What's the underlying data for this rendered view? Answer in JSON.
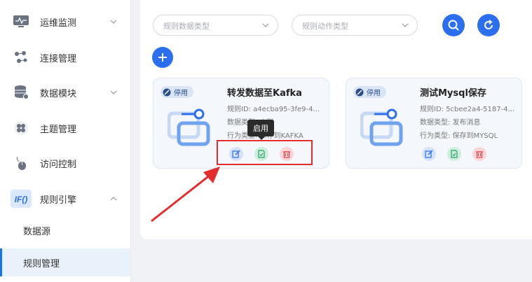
{
  "sidebar": {
    "items": [
      {
        "label": "运维监测",
        "icon": "monitor-icon",
        "expandable": true,
        "expanded": false
      },
      {
        "label": "连接管理",
        "icon": "connection-icon",
        "expandable": false
      },
      {
        "label": "数据模块",
        "icon": "database-icon",
        "expandable": true,
        "expanded": false
      },
      {
        "label": "主题管理",
        "icon": "topic-icon",
        "expandable": false
      },
      {
        "label": "访问控制",
        "icon": "mouse-icon",
        "expandable": false
      },
      {
        "label": "规则引擎",
        "icon": "rule-engine-icon",
        "icon_text": "IF()",
        "expandable": true,
        "expanded": true
      }
    ],
    "sub_items": [
      {
        "label": "数据源",
        "active": false
      },
      {
        "label": "规则管理",
        "active": true
      }
    ]
  },
  "filters": {
    "data_type_placeholder": "规则数据类型",
    "action_type_placeholder": "规则动作类型"
  },
  "colors": {
    "accent": "#2b6fee",
    "highlight": "#e52d2d",
    "badge_bg": "#d9e4f5"
  },
  "cards": [
    {
      "status": "停用",
      "title": "转发数据至Kafka",
      "rule_id": "规则ID: a4ecba95-3fe9-4...",
      "data_type": "数据类型: 上账",
      "action_type": "行为类型: 保存到KAFKA"
    },
    {
      "status": "停用",
      "title": "测试Mysql保存",
      "rule_id": "规则ID: 5cbee2a4-5187-4...",
      "data_type": "数据类型: 发布消息",
      "action_type": "行为类型: 保存到MYSQL"
    }
  ],
  "tooltip": {
    "text": "启用"
  }
}
